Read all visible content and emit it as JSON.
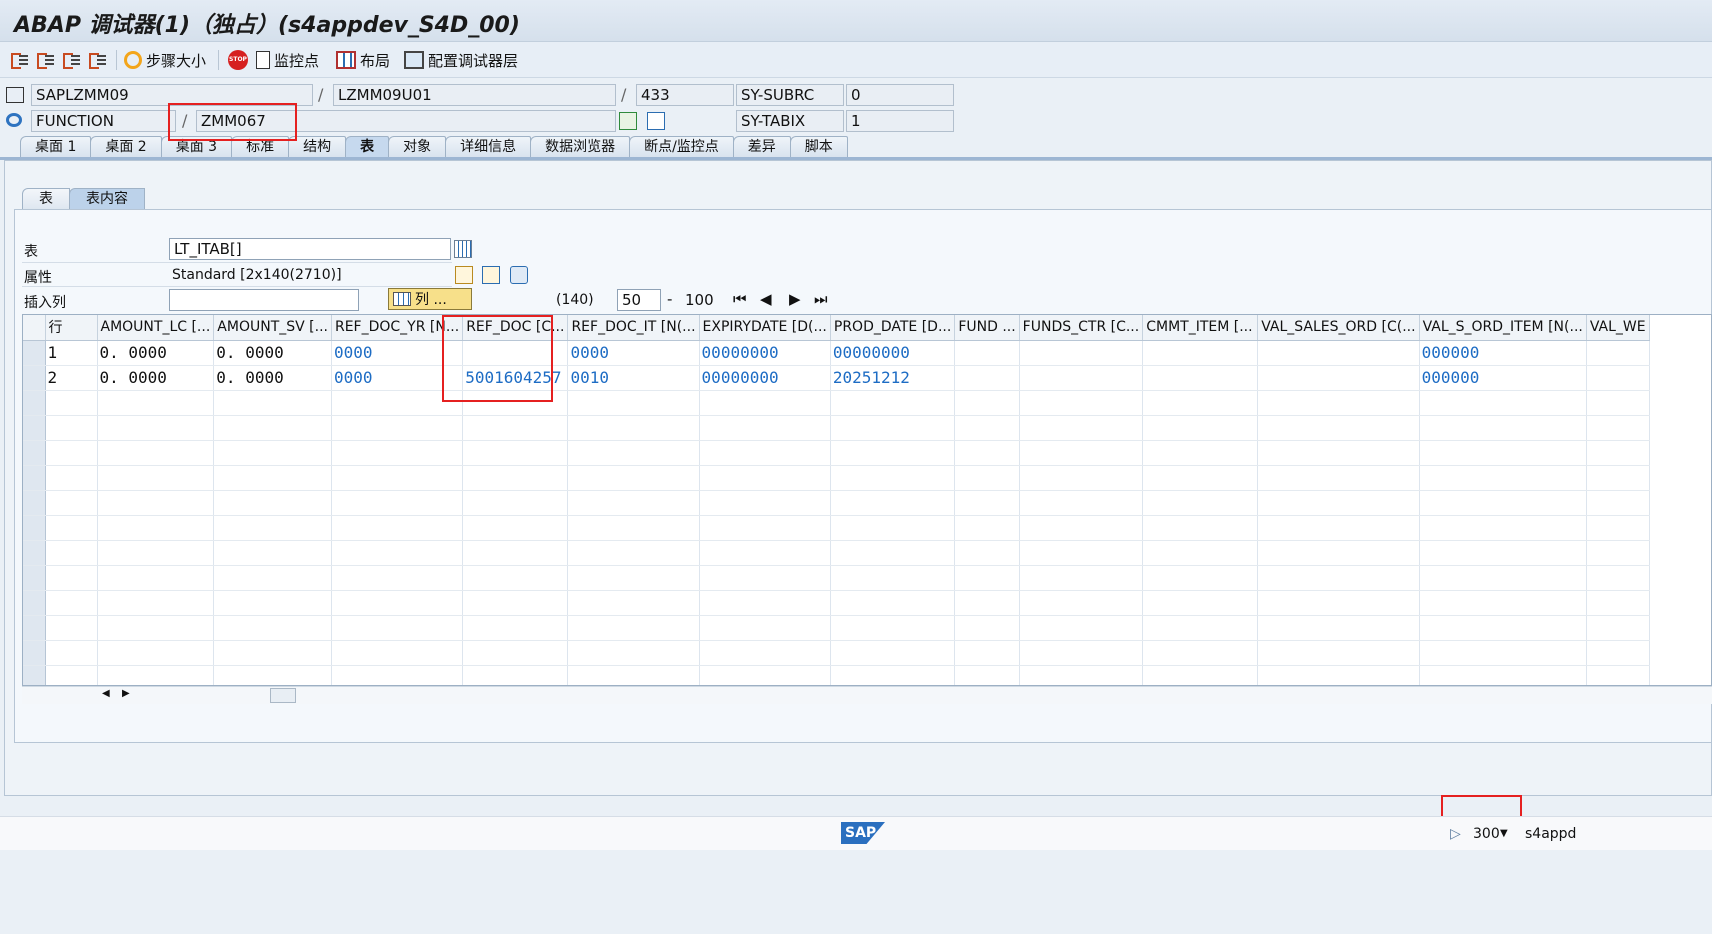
{
  "window": {
    "title": "ABAP 调试器(1)（独占）(s4appdev_S4D_00)"
  },
  "toolbar": {
    "step_size": "步骤大小",
    "watchpoint": "监控点",
    "layout": "布局",
    "config_layer": "配置调试器层"
  },
  "header": {
    "program": "SAPLZMM09",
    "include": "LZMM09U01",
    "line": "433",
    "sy_subrc_label": "SY-SUBRC",
    "sy_subrc_value": "0",
    "event_type": "FUNCTION",
    "event_name": "ZMM067",
    "sy_tabix_label": "SY-TABIX",
    "sy_tabix_value": "1"
  },
  "tabs": [
    {
      "label": "桌面 1"
    },
    {
      "label": "桌面 2"
    },
    {
      "label": "桌面 3"
    },
    {
      "label": "标准"
    },
    {
      "label": "结构"
    },
    {
      "label": "表",
      "active": true
    },
    {
      "label": "对象"
    },
    {
      "label": "详细信息"
    },
    {
      "label": "数据浏览器"
    },
    {
      "label": "断点/监控点"
    },
    {
      "label": "差异"
    },
    {
      "label": "脚本"
    }
  ],
  "subtabs": [
    {
      "label": "表"
    },
    {
      "label": "表内容",
      "active": true
    }
  ],
  "table_panel": {
    "table_label": "表",
    "table_value": "LT_ITAB[]",
    "attr_label": "属性",
    "attr_value": "Standard [2x140(2710)]",
    "insert_col_label": "插入列",
    "insert_col_value": "",
    "columns_button": "列 ...",
    "col_count": "(140)",
    "from_col": "50",
    "dash": "-",
    "to_col": "100"
  },
  "grid": {
    "headers": [
      "行",
      "AMOUNT_LC [...",
      "AMOUNT_SV [...",
      "REF_DOC_YR [N...",
      "REF_DOC [C...",
      "REF_DOC_IT [N(...",
      "EXPIRYDATE [D(...",
      "PROD_DATE [D...",
      "FUND ...",
      "FUNDS_CTR [C...",
      "CMMT_ITEM [...",
      "VAL_SALES_ORD [C(...",
      "VAL_S_ORD_ITEM [N(...",
      "VAL_WE"
    ],
    "rows": [
      [
        "1",
        "0. 0000",
        "0. 0000",
        "0000",
        "",
        "0000",
        "00000000",
        "00000000",
        "",
        "",
        "",
        "",
        "000000",
        ""
      ],
      [
        "2",
        "0. 0000",
        "0. 0000",
        "0000",
        "5001604257",
        "0010",
        "00000000",
        "20251212",
        "",
        "",
        "",
        "",
        "000000",
        ""
      ]
    ]
  },
  "status": {
    "sap_logo": "SAP",
    "client": "300",
    "server": "s4appd"
  },
  "colors": {
    "highlight": "#e52020",
    "link_value": "#1d6cc4",
    "active_tab": "#c6d9ee"
  }
}
